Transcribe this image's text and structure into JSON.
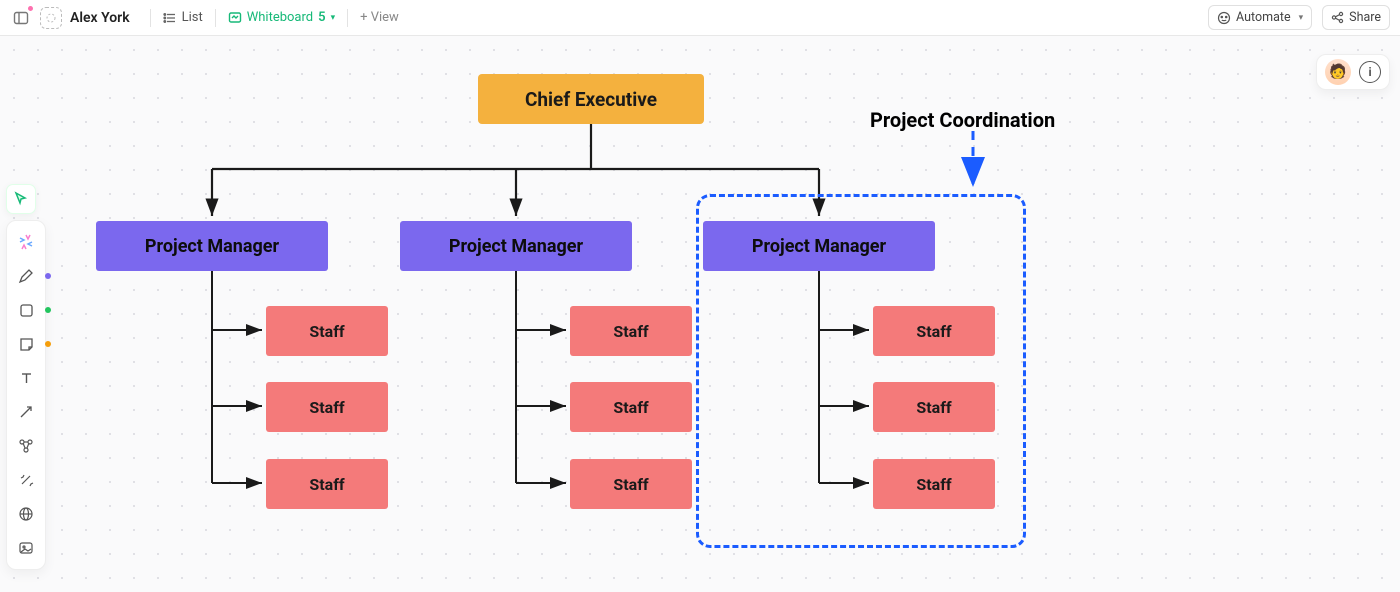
{
  "header": {
    "workspace_name": "Alex York",
    "tabs": {
      "list": {
        "label": "List"
      },
      "whiteboard": {
        "label": "Whiteboard",
        "count": "5"
      },
      "add_view": {
        "label": "+  View"
      }
    },
    "automate_label": "Automate",
    "share_label": "Share"
  },
  "sidebar": {
    "items": [
      {
        "name": "cursor",
        "label": "Select"
      },
      {
        "name": "generate",
        "label": "Generate"
      },
      {
        "name": "pen",
        "label": "Draw",
        "dot": "#7b68ee"
      },
      {
        "name": "shape",
        "label": "Shape",
        "dot": "#22c55e"
      },
      {
        "name": "sticky",
        "label": "Sticky",
        "dot": "#f59e0b"
      },
      {
        "name": "text",
        "label": "Text"
      },
      {
        "name": "connector",
        "label": "Connector"
      },
      {
        "name": "relationship",
        "label": "Relationship"
      },
      {
        "name": "ai",
        "label": "AI"
      },
      {
        "name": "web",
        "label": "Web"
      },
      {
        "name": "image",
        "label": "Image"
      }
    ]
  },
  "chart_data": {
    "type": "org-chart",
    "title": "",
    "annotation": "Project Coordination",
    "root": {
      "label": "Chief Executive",
      "color": "#f4b13e"
    },
    "branches": [
      {
        "label": "Project Manager",
        "color": "#7b68ee",
        "children": [
          {
            "label": "Staff",
            "color": "#f47a7a"
          },
          {
            "label": "Staff",
            "color": "#f47a7a"
          },
          {
            "label": "Staff",
            "color": "#f47a7a"
          }
        ]
      },
      {
        "label": "Project Manager",
        "color": "#7b68ee",
        "children": [
          {
            "label": "Staff",
            "color": "#f47a7a"
          },
          {
            "label": "Staff",
            "color": "#f47a7a"
          },
          {
            "label": "Staff",
            "color": "#f47a7a"
          }
        ]
      },
      {
        "label": "Project Manager",
        "color": "#7b68ee",
        "highlighted": true,
        "children": [
          {
            "label": "Staff",
            "color": "#f47a7a"
          },
          {
            "label": "Staff",
            "color": "#f47a7a"
          },
          {
            "label": "Staff",
            "color": "#f47a7a"
          }
        ]
      }
    ]
  },
  "colors": {
    "accent": "#17b978",
    "highlight": "#1b5cff"
  }
}
